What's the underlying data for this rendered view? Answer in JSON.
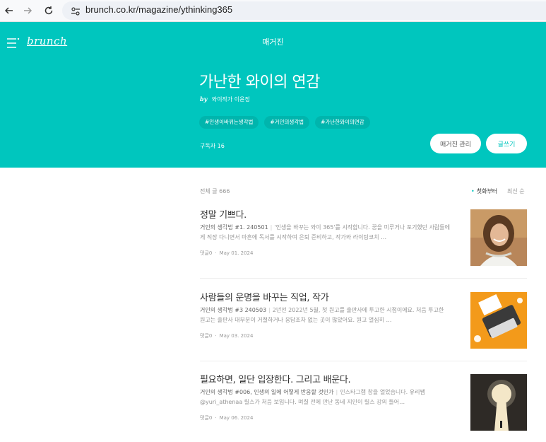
{
  "browser": {
    "url": "brunch.co.kr/magazine/ythinking365"
  },
  "header": {
    "logo": "brunch",
    "title": "매거진"
  },
  "magazine": {
    "title": "가난한 와이의 연감",
    "by": "by",
    "author": "와이작가 이윤정",
    "tags": [
      "#인생이바뀌는생각법",
      "#거인의생각법",
      "#가난한와이의연감"
    ],
    "subscribers": "구독자 16",
    "manage_button": "매거진 관리",
    "write_button": "글쓰기"
  },
  "list": {
    "total": "전체 글 666",
    "sort_first": "첫화부터",
    "sort_latest": "최신 순",
    "articles": [
      {
        "title": "정말 기쁘다.",
        "subtitle": "거인의 생각법 #1. 240501",
        "excerpt": "'인생을 바꾸는 와이 365'를 시작합니다. 꿈을 미루거나 포기했던 사람들에게 직장 다니면서 마흔에 독서를 시작하여 은퇴 준비하고, 작가와 라이팅코치 …",
        "comments": "댓글0",
        "date": "May 01. 2024"
      },
      {
        "title": "사람들의 운명을 바꾸는 직업, 작가",
        "subtitle": "거인의 생각법 #3 240503",
        "excerpt": "2년전 2022년 5월, 첫 원고를 출판사에 투고한 시점이에요. 처음 투고한 원고는 출판사 대부분이 거절하거나 응답조차 없는 곳이 많았어요. 원고 열심히 …",
        "comments": "댓글0",
        "date": "May 03. 2024"
      },
      {
        "title": "필요하면, 일단 입장한다. 그리고 배운다.",
        "subtitle": "거인의 생각법 #006, 인생의 일에 어떻게 반응할 것인가",
        "excerpt": "인스타그램 창을 열었습니다. 유리쌤 @yuri_athenaa 릴스가 처음 보입니다. 며칠 전에 만난 동네 지인이 릴스 강의 들어…",
        "comments": "댓글0",
        "date": "May 06. 2024"
      }
    ]
  },
  "colors": {
    "brand": "#00c6be",
    "tag_bg": "#00b5ad"
  }
}
